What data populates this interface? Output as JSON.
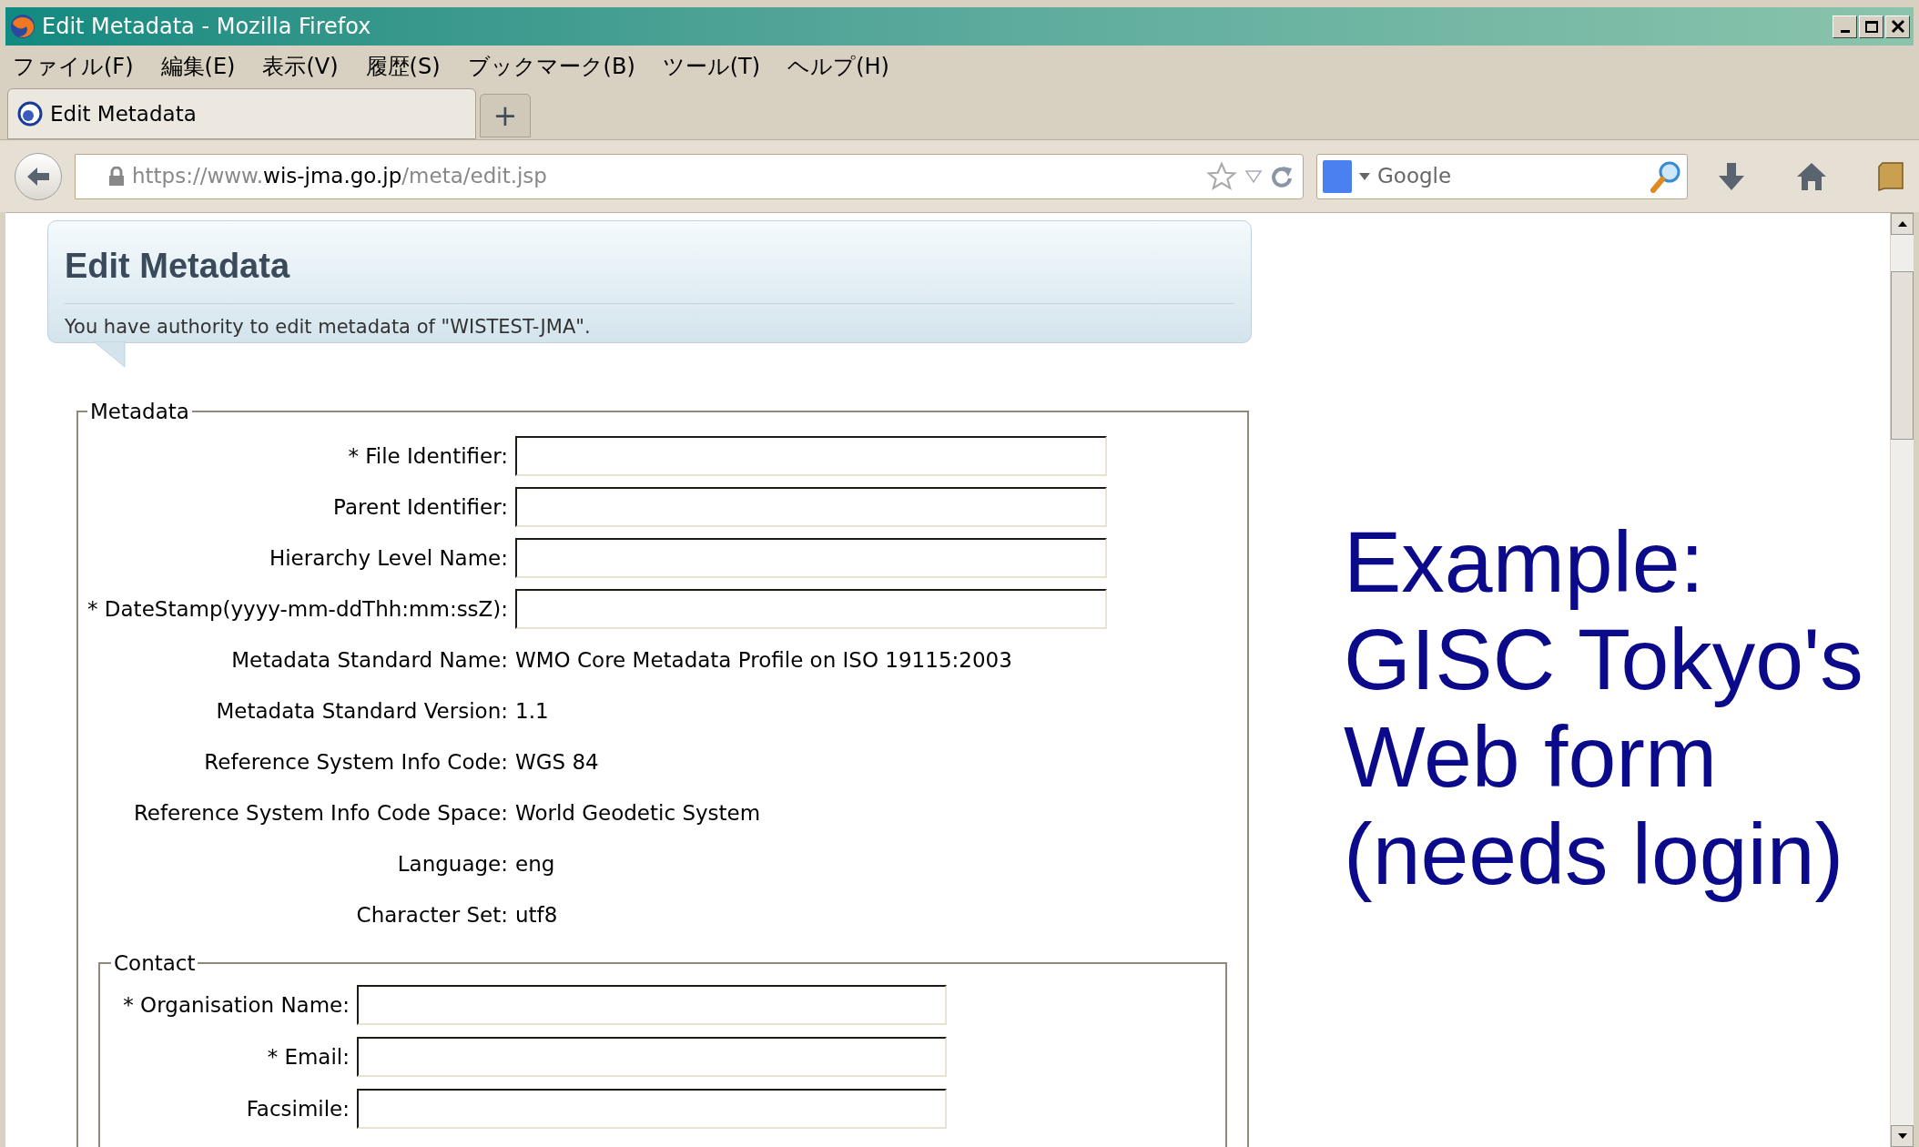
{
  "window": {
    "title": "Edit Metadata - Mozilla Firefox",
    "controls": [
      {
        "kind": "minimize"
      },
      {
        "kind": "maximize"
      },
      {
        "kind": "close"
      }
    ]
  },
  "menu": [
    "ファイル(F)",
    "編集(E)",
    "表示(V)",
    "履歴(S)",
    "ブックマーク(B)",
    "ツール(T)",
    "ヘルプ(H)"
  ],
  "tabs": [
    {
      "label": "Edit Metadata",
      "selected": true
    }
  ],
  "new_tab": "+",
  "address": {
    "scheme": "https://www.",
    "host": "wis-jma.go.jp",
    "path": "/meta/edit.jsp"
  },
  "search": {
    "placeholder": "Google"
  },
  "page": {
    "title": "Edit Metadata",
    "notice": "You have authority to edit metadata of \"WISTEST-JMA\".",
    "metadata": {
      "legend": "Metadata",
      "fields": [
        {
          "kind": "input",
          "label": "* File Identifier:"
        },
        {
          "kind": "input",
          "label": "Parent Identifier:"
        },
        {
          "kind": "input",
          "label": "Hierarchy Level Name:"
        },
        {
          "kind": "input",
          "label": "* DateStamp(yyyy-mm-ddThh:mm:ssZ):"
        },
        {
          "kind": "static",
          "label": "Metadata Standard Name:",
          "value": "WMO Core Metadata Profile on ISO 19115:2003"
        },
        {
          "kind": "static",
          "label": "Metadata Standard Version:",
          "value": "1.1"
        },
        {
          "kind": "static",
          "label": "Reference System Info Code:",
          "value": "WGS 84"
        },
        {
          "kind": "static",
          "label": "Reference System Info Code Space:",
          "value": "World Geodetic System"
        },
        {
          "kind": "static",
          "label": "Language:",
          "value": "eng"
        },
        {
          "kind": "static",
          "label": "Character Set:",
          "value": "utf8"
        }
      ]
    },
    "contact": {
      "legend": "Contact",
      "fields": [
        {
          "kind": "input",
          "label": "* Organisation Name:"
        },
        {
          "kind": "input",
          "label": "* Email:"
        },
        {
          "kind": "input",
          "label": "Facsimile:"
        }
      ]
    }
  },
  "caption": [
    "Example:",
    "GISC Tokyo's",
    "Web form",
    "(needs login)"
  ]
}
